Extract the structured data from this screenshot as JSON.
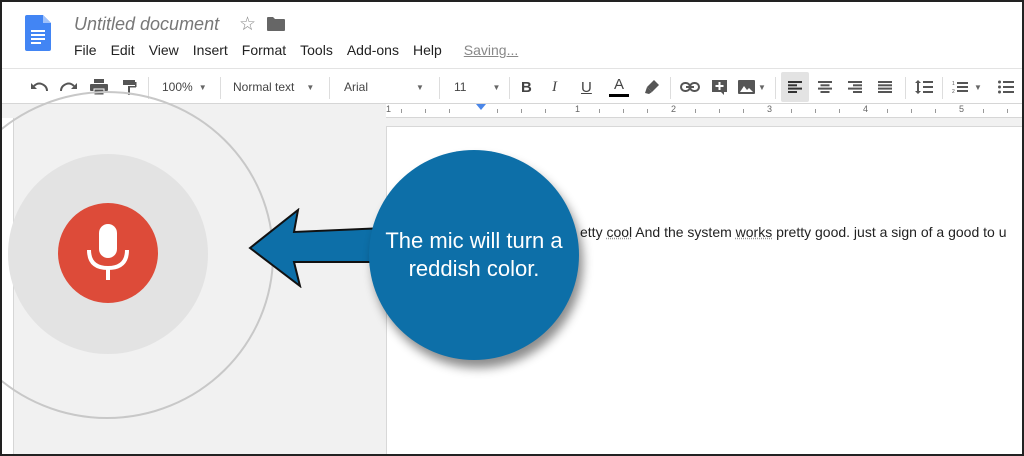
{
  "document": {
    "title": "Untitled document"
  },
  "menu": {
    "items": [
      "File",
      "Edit",
      "View",
      "Insert",
      "Format",
      "Tools",
      "Add-ons",
      "Help"
    ],
    "status": "Saving..."
  },
  "toolbar": {
    "zoom": "100%",
    "style": "Normal text",
    "font": "Arial",
    "size": "11",
    "bold": "B",
    "italic": "I",
    "underline": "U",
    "text_color_letter": "A",
    "highlight_color": "#000000"
  },
  "ruler": {
    "numbers": [
      "1",
      "1",
      "2",
      "3",
      "4",
      "5"
    ]
  },
  "body_text": {
    "prefix": "etty ",
    "w1": "cool",
    "mid": " And the system ",
    "w2": "works",
    "suffix": " pretty good. just a sign of a good to u"
  },
  "mic": {
    "icon": "microphone-icon",
    "color": "#dd4b39"
  },
  "callout": {
    "text": "The mic will turn a reddish color.",
    "color": "#0d6fa8"
  }
}
